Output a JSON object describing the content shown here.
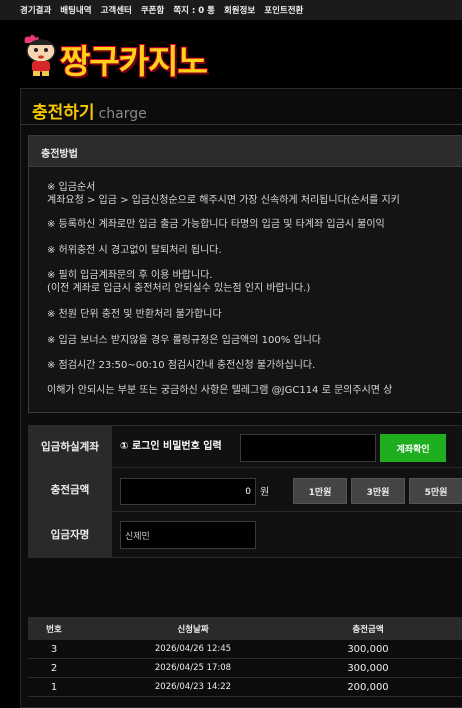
{
  "topnav": {
    "items": [
      "경기결과",
      "배팅내역",
      "고객센터",
      "쿠폰함",
      "쪽지 : 0 통",
      "회원정보",
      "포인트전환"
    ]
  },
  "logo": {
    "text": "짱구카지노",
    "colors": {
      "fill": "#ffd21a",
      "stroke": "#e0002a"
    }
  },
  "page": {
    "title": "충전하기",
    "subtitle": "charge",
    "accent": "#f6c600"
  },
  "method": {
    "heading": "충전방법",
    "notes": [
      "※ 입금순서",
      "계좌요청 > 입금 > 입금신청순으로 해주시면 가장 신속하게 처리됩니다(순서를 지키",
      "※ 등록하신 계좌로만 입금 출금 가능합니다 타명의 입금 및 타계좌 입금시 불이익",
      "※ 허위충전 시 경고없이 탈퇴처리 됩니다.",
      "※ 필히 입금계좌문의 후 이용 바랍니다.",
      "(이전 계좌로 입금시 충전처리 안되실수 있는점 인지 바랍니다.)",
      "※ 천원 단위 충전 및 반환처리 불가합니다",
      "※ 입금 보너스 받지않을 경우 롤링규정은 입금액의 100% 입니다",
      "※ 점검시간 23:50~00:10 점검시간내 충전신청 불가하십니다.",
      "이해가 안되시는 부분 또는 궁금하신 사항은 텔레그램 @JGC114 로 문의주시면 상"
    ]
  },
  "form": {
    "account": {
      "label": "입금하실계좌",
      "password_label": "① 로그인 비밀번호 입력",
      "password_value": "",
      "confirm_button": "계좌확인"
    },
    "amount": {
      "label": "충전금액",
      "value": "0",
      "unit": "원",
      "quick_buttons": [
        "1만원",
        "3만원",
        "5만원"
      ]
    },
    "depositor": {
      "label": "입금자명",
      "value": "신제민"
    }
  },
  "history": {
    "headers": [
      "번호",
      "신청날짜",
      "충전금액"
    ],
    "rows": [
      [
        "3",
        "2026/04/26 12:45",
        "300,000"
      ],
      [
        "2",
        "2026/04/25 17:08",
        "300,000"
      ],
      [
        "1",
        "2026/04/23 14:22",
        "200,000"
      ]
    ]
  }
}
